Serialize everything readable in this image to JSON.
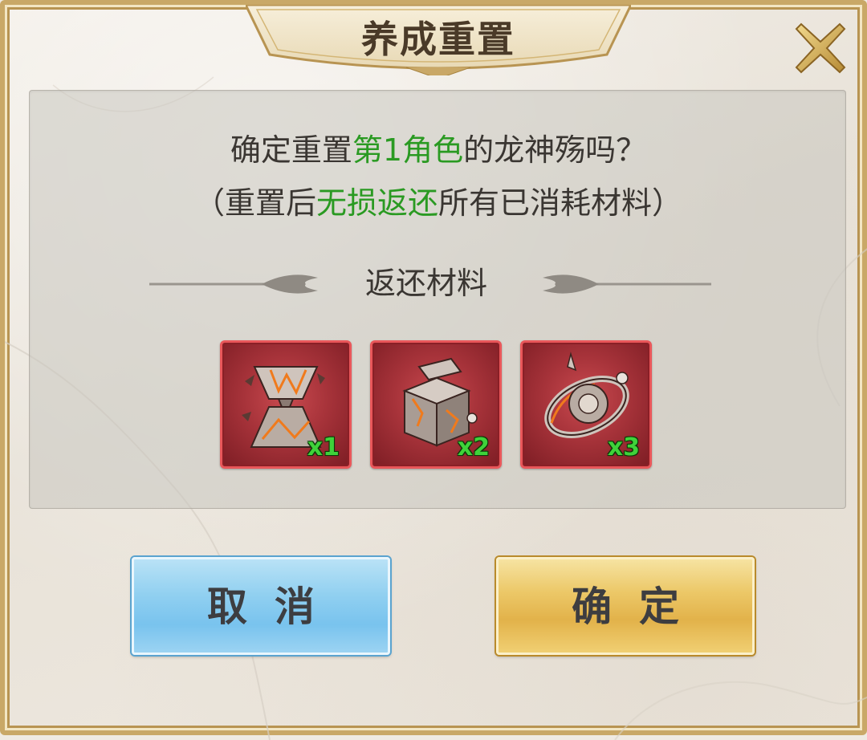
{
  "dialog": {
    "title": "养成重置",
    "close_icon": "close-x-icon"
  },
  "message": {
    "line1_prefix": "确定重置",
    "line1_highlight": "第1角色",
    "line1_suffix": "的龙神殇吗？",
    "line2_prefix": "（重置后",
    "line2_highlight": "无损返还",
    "line2_suffix": "所有已消耗材料）",
    "highlight_color": "#2a9a22"
  },
  "materials": {
    "section_title": "返还材料",
    "items": [
      {
        "icon": "hourglass-relic-icon",
        "quantity": "x1"
      },
      {
        "icon": "metal-cube-relic-icon",
        "quantity": "x2"
      },
      {
        "icon": "orb-ring-relic-icon",
        "quantity": "x3"
      }
    ],
    "quantity_color": "#3fd23a"
  },
  "buttons": {
    "cancel_label": "取消",
    "confirm_label": "确定"
  }
}
